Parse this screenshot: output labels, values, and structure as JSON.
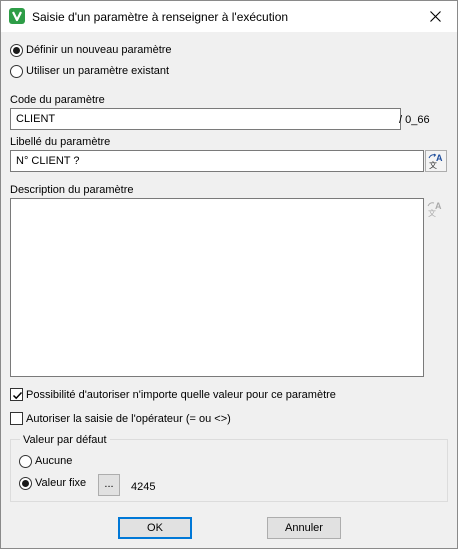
{
  "window": {
    "title": "Saisie d'un paramètre à renseigner à l'exécution"
  },
  "mode": {
    "option_new": "Définir un nouveau paramètre",
    "option_existing": "Utiliser un paramètre existant",
    "selected": "new"
  },
  "code": {
    "label": "Code du paramètre",
    "value": "CLIENT",
    "suffix": "/ 0_66"
  },
  "libelle": {
    "label": "Libellé du paramètre",
    "value": "N° CLIENT ?"
  },
  "description": {
    "label": "Description du paramètre",
    "value": ""
  },
  "options": {
    "allow_any_label": "Possibilité d'autoriser n'importe quelle valeur pour ce paramètre",
    "allow_any_checked": true,
    "operator_input_label": "Autoriser la saisie de l'opérateur (= ou <>)",
    "operator_input_checked": false
  },
  "default_value": {
    "group_label": "Valeur par défaut",
    "option_none": "Aucune",
    "option_fixed": "Valeur fixe",
    "selected": "fixed",
    "browse_label": "...",
    "fixed_value": "4245"
  },
  "buttons": {
    "ok": "OK",
    "cancel": "Annuler"
  },
  "icons": {
    "app": "v-logo-icon",
    "close": "close-icon",
    "translate": "translate-icon"
  }
}
